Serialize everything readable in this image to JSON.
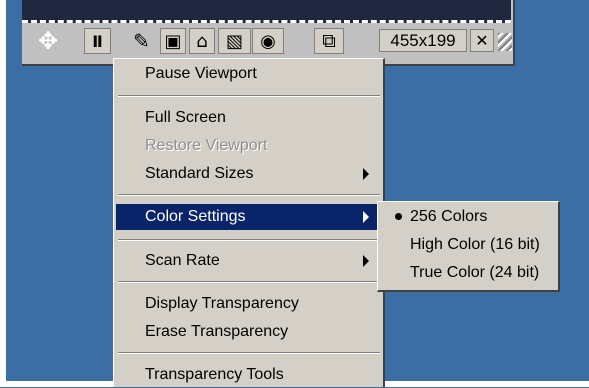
{
  "toolbar": {
    "size_value": "455x199"
  },
  "menu": {
    "items": [
      {
        "label": "Pause Viewport"
      },
      {
        "label": "Full Screen"
      },
      {
        "label": "Restore Viewport"
      },
      {
        "label": "Standard Sizes"
      },
      {
        "label": "Color Settings"
      },
      {
        "label": "Scan Rate"
      },
      {
        "label": "Display Transparency"
      },
      {
        "label": "Erase Transparency"
      },
      {
        "label": "Transparency Tools"
      }
    ]
  },
  "submenu": {
    "items": [
      {
        "label": "256 Colors",
        "checked": true
      },
      {
        "label": "High Color (16 bit)",
        "checked": false
      },
      {
        "label": "True Color (24 bit)",
        "checked": false
      }
    ]
  },
  "colors": {
    "desktop": "#3a6ea5",
    "highlight": "#0a246a",
    "menu_bg": "#d4d0c8"
  },
  "icons": [
    "move-icon",
    "pause-icon",
    "pencil-icon",
    "edit-document-icon",
    "arrange-icon",
    "image-edit-icon",
    "camera-icon",
    "display-settings-icon",
    "close-icon",
    "resize-grip-icon"
  ]
}
